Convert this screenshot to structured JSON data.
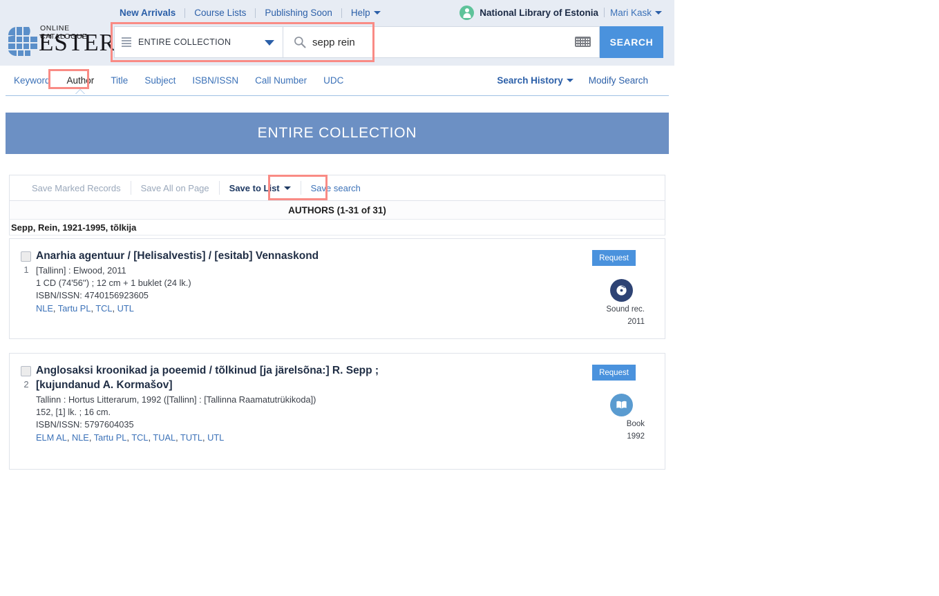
{
  "header": {
    "top_links": [
      {
        "label": "New Arrivals",
        "bold": true
      },
      {
        "label": "Course Lists",
        "bold": false
      },
      {
        "label": "Publishing Soon",
        "bold": false
      },
      {
        "label": "Help",
        "bold": false,
        "caret": true
      }
    ],
    "org_name": "National Library of Estonia",
    "user_name": "Mari Kask",
    "logo": {
      "line1": "ONLINE CATALOGUE",
      "line2": "ESTER"
    },
    "search": {
      "scope_label": "ENTIRE COLLECTION",
      "query_value": "sepp rein",
      "query_placeholder": "",
      "search_button": "SEARCH"
    }
  },
  "tabs": {
    "left": [
      {
        "label": "Keyword",
        "active": false
      },
      {
        "label": "Author",
        "active": true
      },
      {
        "label": "Title",
        "active": false
      },
      {
        "label": "Subject",
        "active": false
      },
      {
        "label": "ISBN/ISSN",
        "active": false
      },
      {
        "label": "Call Number",
        "active": false
      },
      {
        "label": "UDC",
        "active": false
      }
    ],
    "right": [
      {
        "label": "Search History",
        "caret": true,
        "bold": true
      },
      {
        "label": "Modify Search",
        "caret": false,
        "bold": false
      }
    ]
  },
  "banner": {
    "title": "ENTIRE COLLECTION"
  },
  "toolbar": {
    "save_marked": "Save Marked Records",
    "save_all": "Save All on Page",
    "save_to_list": "Save to List",
    "save_search": "Save search"
  },
  "results": {
    "heading": "AUTHORS (1-31 of 31)",
    "author_heading": "Sepp, Rein, 1921-1995, tõlkija",
    "records": [
      {
        "number": "1",
        "title": "Anarhia agentuur / [Helisalvestis] / [esitab] Vennaskond",
        "imprint": "[Tallinn] : Elwood, 2011",
        "extent": "1 CD (74'56'') ; 12 cm + 1 buklet (24 lk.)",
        "isbn": "ISBN/ISSN:  4740156923605",
        "libraries": "NLE, Tartu PL, TCL, UTL",
        "request_label": "Request",
        "media_type": "Sound rec.",
        "media_year": "2011",
        "media_icon": "sound-recording-icon"
      },
      {
        "number": "2",
        "title": "Anglosaksi kroonikad ja poeemid / tõlkinud [ja järelsõna:] R. Sepp ; [kujundanud A. Kormašov]",
        "imprint": "Tallinn : Hortus Litterarum, 1992 ([Tallinn] : [Tallinna Raamatutrükikoda])",
        "extent": "152, [1] lk. ; 16 cm.",
        "isbn": "ISBN/ISSN:  5797604035",
        "libraries": "ELM AL, NLE, Tartu PL, TCL, TUAL, TUTL, UTL",
        "request_label": "Request",
        "media_type": "Book",
        "media_year": "1992",
        "media_icon": "book-icon"
      }
    ]
  },
  "annotations": {
    "search_box": "search-area-highlight",
    "author_tab": "author-tab-highlight",
    "save_search": "save-search-highlight",
    "color": "#f98b85"
  },
  "colors": {
    "header_bg": "#e7ecf4",
    "accent_blue": "#4a92dd",
    "banner_blue": "#6c90c4",
    "link_blue": "#3c72b8",
    "avatar_green": "#5ec39a"
  }
}
